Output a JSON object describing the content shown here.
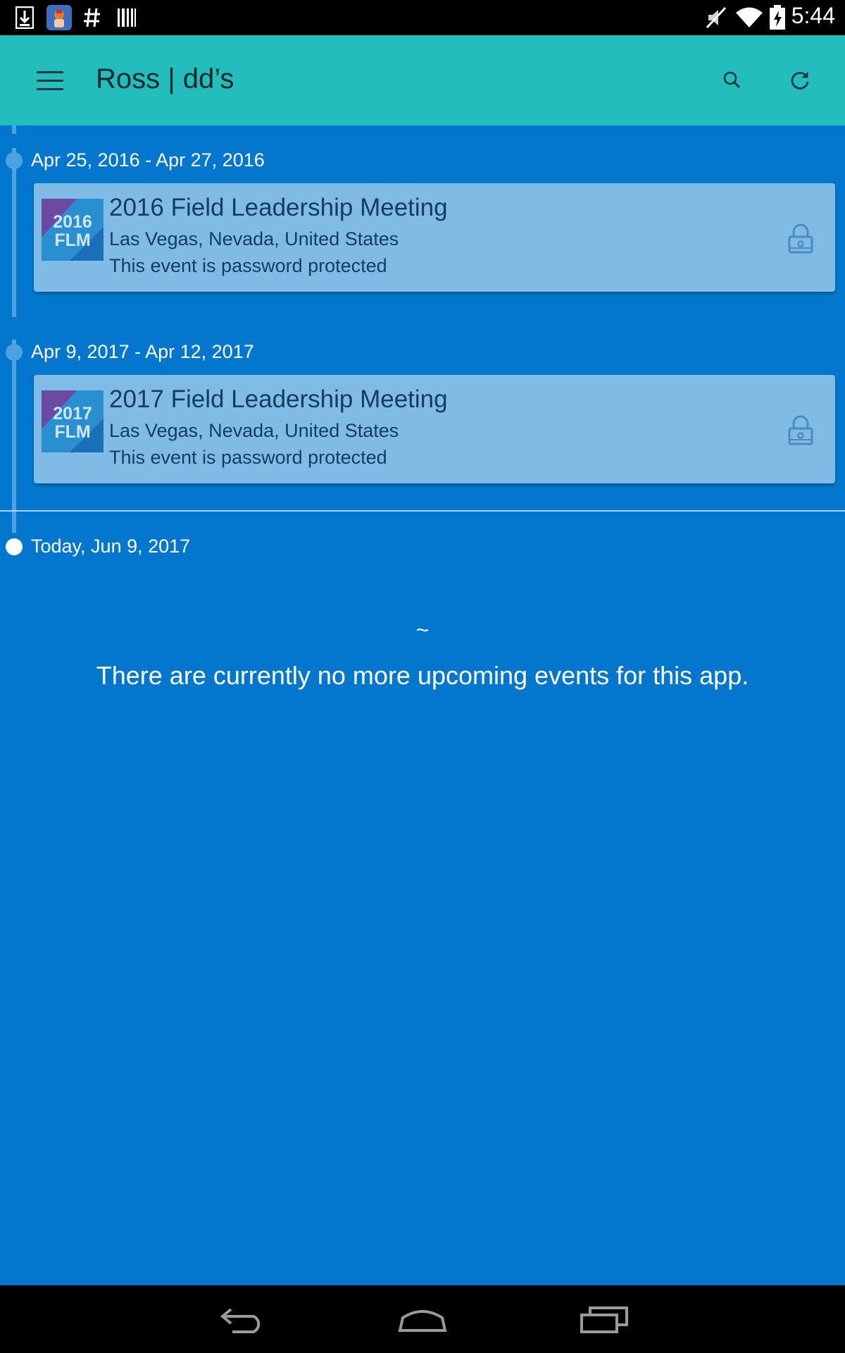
{
  "status_bar": {
    "time": "5:44",
    "left_icons": [
      "download-icon",
      "app-notification-icon",
      "hashtag-icon",
      "barcode-icon"
    ],
    "right_icons": [
      "mute-icon",
      "wifi-icon",
      "battery-charging-icon"
    ]
  },
  "app_bar": {
    "title": "Ross | dd’s",
    "color": "#23bdbd",
    "icons": [
      "menu-icon",
      "search-icon",
      "refresh-icon"
    ]
  },
  "timeline": {
    "background": "#0277cd",
    "groups": [
      {
        "date_range": "Apr 25, 2016 - Apr 27, 2016",
        "event": {
          "name": "2016 Field Leadership Meeting",
          "location": "Las Vegas, Nevada, United States",
          "status": "This event is password protected",
          "logo_year": "2016",
          "logo_text": "FLM",
          "icon": "lock-icon"
        }
      },
      {
        "date_range": "Apr 9, 2017 - Apr 12, 2017",
        "event": {
          "name": "2017 Field Leadership Meeting",
          "location": "Las Vegas, Nevada, United States",
          "status": "This event is password protected",
          "logo_year": "2017",
          "logo_text": "FLM",
          "icon": "lock-icon"
        }
      }
    ],
    "today_label": "Today, Jun 9, 2017",
    "empty_symbol": "~",
    "empty_message": "There are currently no more upcoming events for this app."
  },
  "nav_bar": {
    "icons": [
      "back-icon",
      "home-icon",
      "recents-icon"
    ]
  }
}
